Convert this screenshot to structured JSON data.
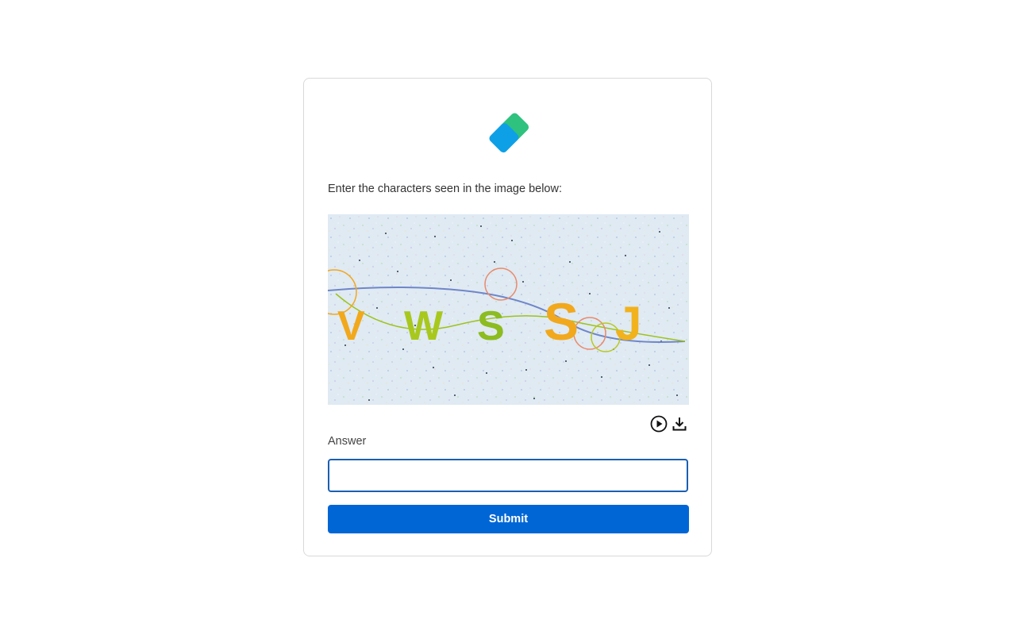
{
  "prompt": "Enter the characters seen in the image below:",
  "captcha": {
    "characters": [
      "V",
      "W",
      "S",
      "S",
      "J"
    ],
    "character_colors": [
      "#f2a81c",
      "#a8c81e",
      "#8cbc20",
      "#f2a81c",
      "#f2b21c"
    ]
  },
  "media_controls": {
    "play_icon": "play-circle-icon",
    "download_icon": "download-icon"
  },
  "answer": {
    "label": "Answer",
    "value": "",
    "placeholder": ""
  },
  "submit": {
    "label": "Submit"
  },
  "colors": {
    "logo_green": "#2ec27e",
    "logo_blue": "#0ea0e6",
    "input_border": "#1a5fb4",
    "button_bg": "#0066d6"
  }
}
